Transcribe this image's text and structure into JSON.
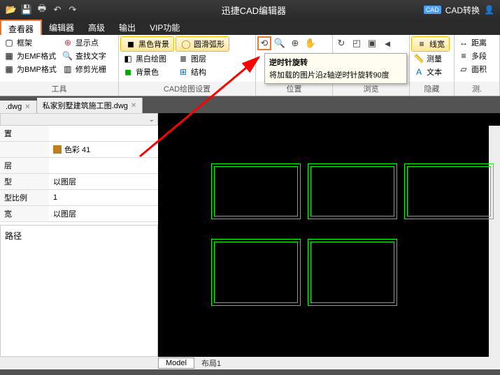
{
  "title": "迅捷CAD编辑器",
  "cad_convert": "CAD转换",
  "menu": {
    "viewer": "查看器",
    "editor": "编辑器",
    "advanced": "高级",
    "output": "输出",
    "vip": "VIP功能"
  },
  "ribbon": {
    "tools": {
      "label": "工具",
      "frame": "框架",
      "show_point": "显示点",
      "emf": "为EMF格式",
      "find_text": "查找文字",
      "bmp": "为BMP格式",
      "trim_grating": "修剪光栅"
    },
    "cad_draw": {
      "label": "CAD绘图设置",
      "black_bg": "黑色背景",
      "smooth_arc": "圆滑弧形",
      "bw_draw": "黑白绘图",
      "layer": "图层",
      "bg_color": "背景色",
      "structure": "结构"
    },
    "position": {
      "label": "位置"
    },
    "view": {
      "label": "浏览"
    },
    "hide": {
      "label": "隐藏"
    },
    "measure": {
      "linewidth": "线宽",
      "distance": "距离",
      "measure": "测量",
      "multi": "多段",
      "text": "文本",
      "area": "面积"
    }
  },
  "tooltip": {
    "title": "逆时针旋转",
    "body": "将加载的图片沿z轴逆时针旋转90度"
  },
  "files": {
    "tab1": ".dwg",
    "tab2": "私家别墅建筑施工图.dwg"
  },
  "props": {
    "zhi": "置",
    "ceng": "层",
    "xing": "型",
    "xingbili": "型比例",
    "kuan": "宽",
    "color_label": "色彩 41",
    "bylayer": "以图层",
    "one": "1"
  },
  "path_label": "路径",
  "bottom": {
    "model": "Model",
    "layout": "布局1"
  }
}
